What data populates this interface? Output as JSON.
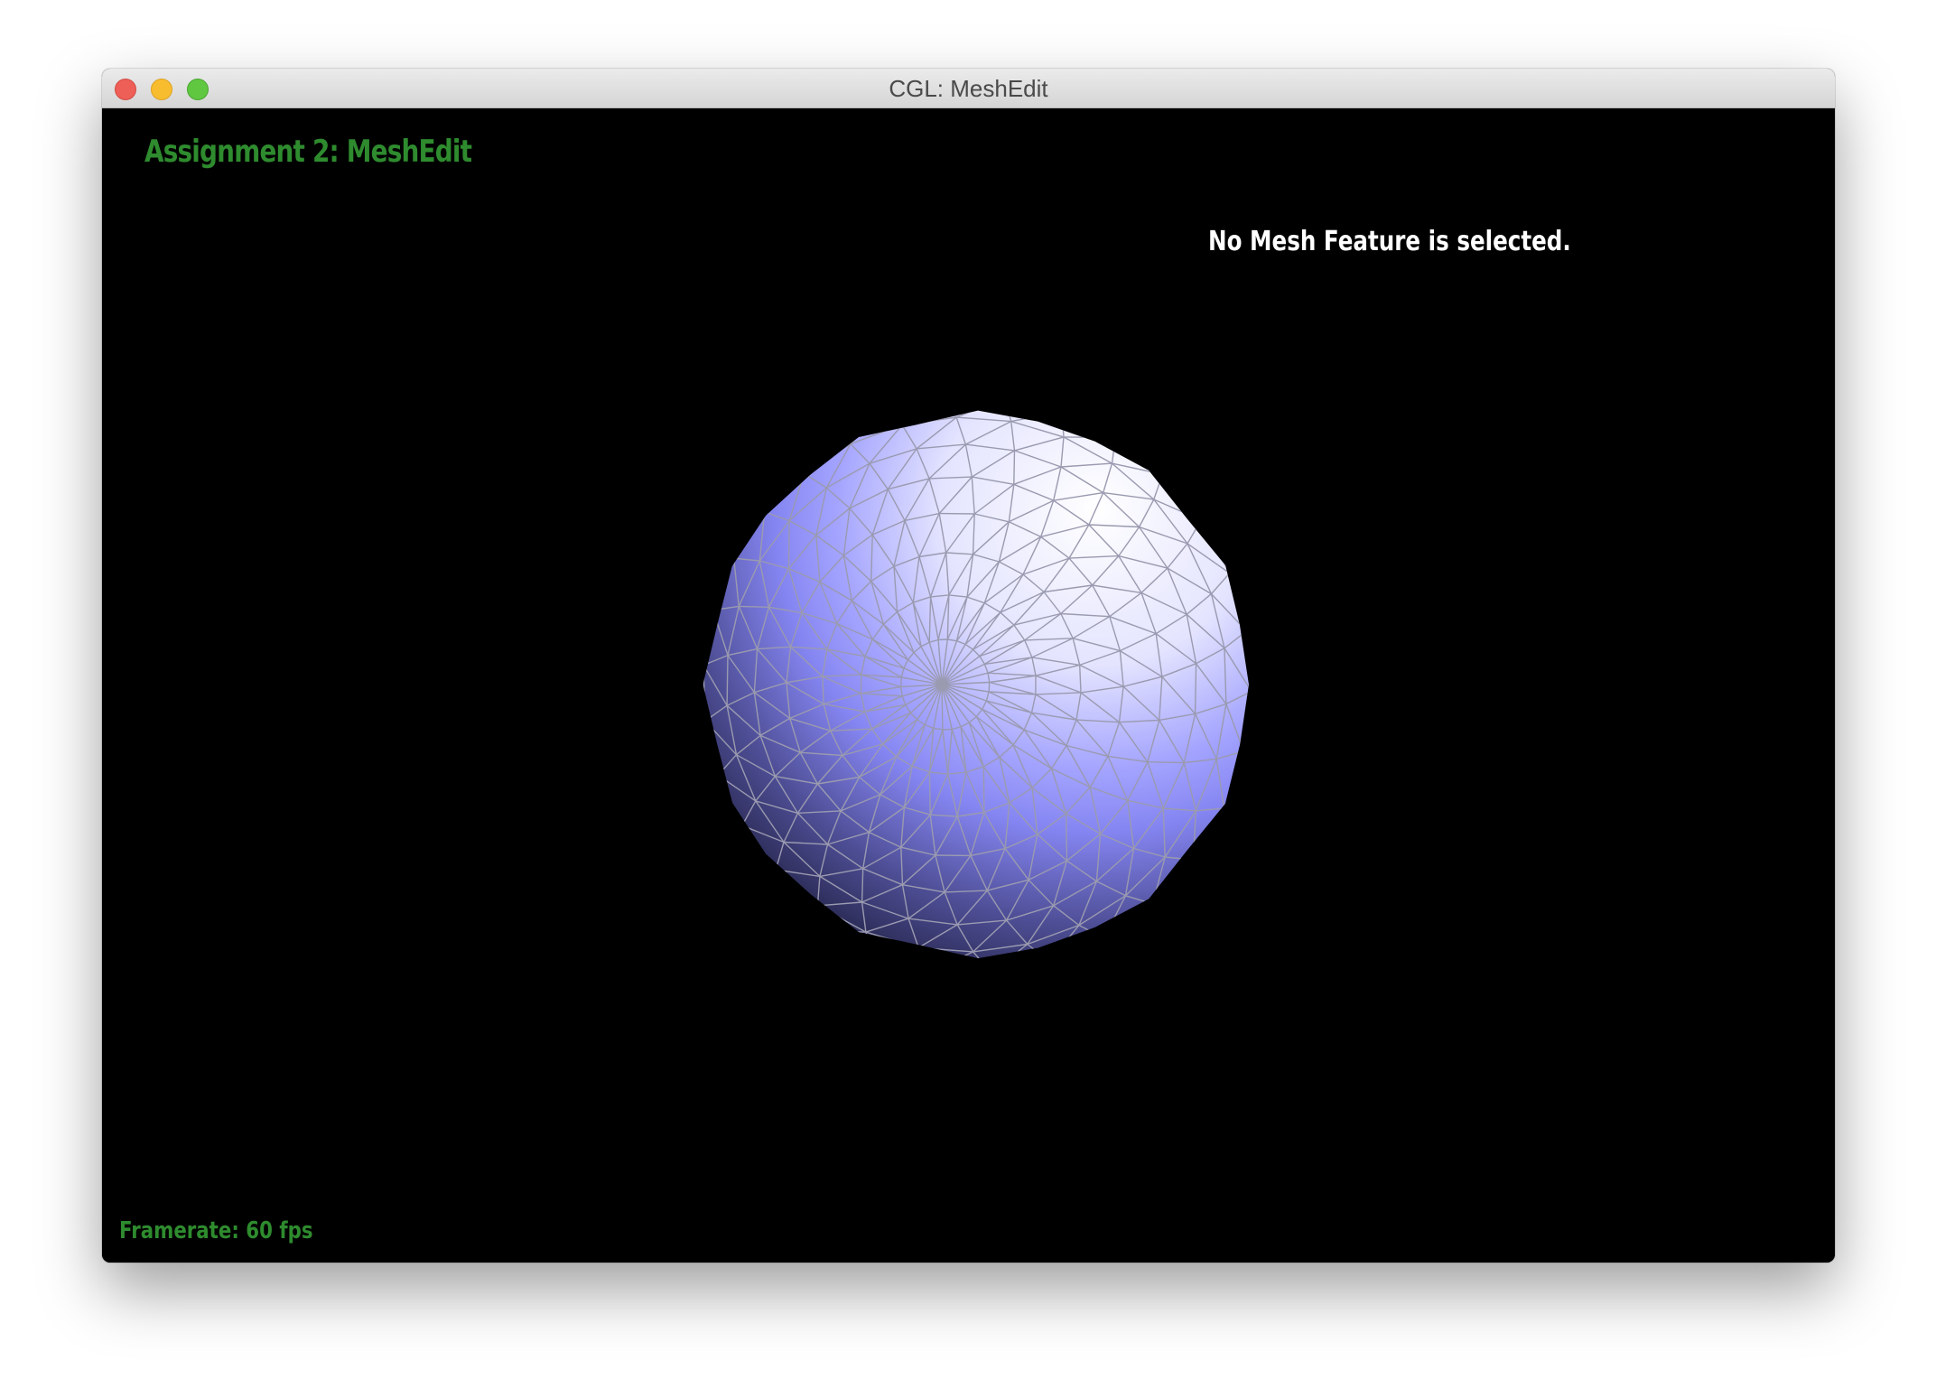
{
  "window": {
    "title": "CGL: MeshEdit"
  },
  "viewport": {
    "assignment_title": "Assignment 2: MeshEdit",
    "selection_status": "No Mesh Feature is selected.",
    "framerate_label": "Framerate: 60 fps"
  },
  "colors": {
    "overlay_green": "#2e8b2e",
    "mesh_light": "#f2f2ff",
    "mesh_mid": "#8c8cff",
    "mesh_dark": "#202040",
    "wireframe": "#9a9ab0"
  },
  "icons": {
    "close": "close-traffic-light-icon",
    "minimize": "minimize-traffic-light-icon",
    "maximize": "maximize-traffic-light-icon"
  }
}
